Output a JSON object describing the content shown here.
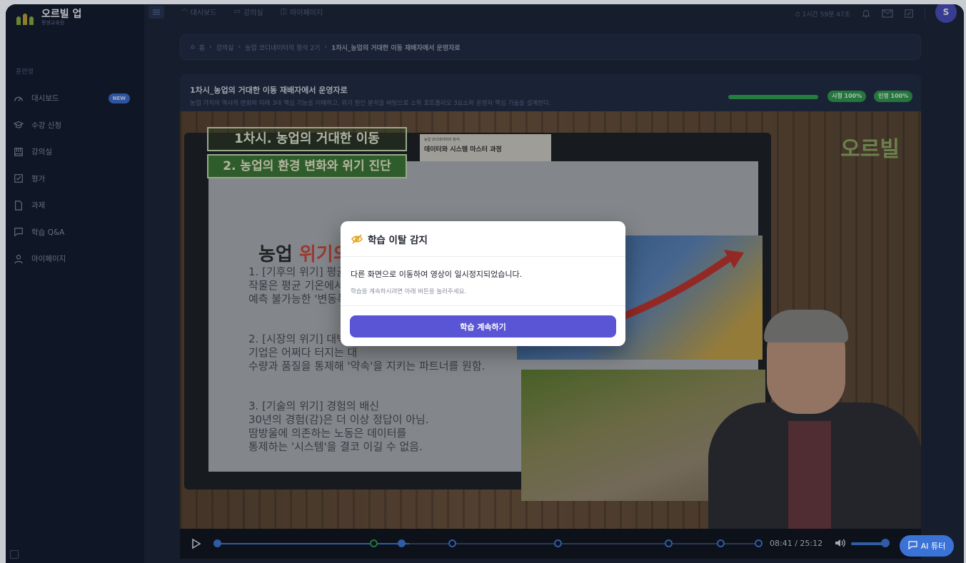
{
  "brand": {
    "title": "오르빌 업",
    "subtitle": "평생교육원"
  },
  "sidebar": {
    "section_label": "훈련생",
    "items": [
      {
        "label": "대시보드",
        "icon": "dashboard-icon",
        "badge": "NEW"
      },
      {
        "label": "수강 신청",
        "icon": "graduation-cap-icon"
      },
      {
        "label": "강의실",
        "icon": "classroom-icon"
      },
      {
        "label": "평가",
        "icon": "checkbox-icon"
      },
      {
        "label": "과제",
        "icon": "document-icon"
      },
      {
        "label": "학습 Q&A",
        "icon": "chat-icon"
      },
      {
        "label": "마이페이지",
        "icon": "user-icon"
      }
    ]
  },
  "topbar": {
    "links": [
      {
        "label": "대시보드",
        "icon": "dashboard-icon"
      },
      {
        "label": "강의실",
        "icon": "classroom-icon"
      },
      {
        "label": "마이페이지",
        "icon": "mypage-icon"
      }
    ],
    "timer": "⏱ 1시간 59분 47초",
    "avatar_initial": "S"
  },
  "breadcrumb": {
    "home": "홈",
    "items": [
      "강의실",
      "농업 코디네이터의 정석 2기"
    ],
    "current": "1차시_농업의 거대한 이동 재배자에서 운영자로"
  },
  "lecture": {
    "title": "1차시_농업의 거대한 이동 재배자에서 운영자로",
    "description": "농업 가치의 역사적 변화와 미래 3대 핵심 기능을 이해하고, 위기 원인 분석을 바탕으로 소득 포트폴리오 3요소와 운영자 핵심 기술을 설계한다.",
    "progress_percent": 100,
    "badge_view": "시청 100%",
    "badge_cert": "인정 100%"
  },
  "slide": {
    "title1": "1차시. 농업의 거대한 이동",
    "title2": "2. 농업의 환경 변화와 위기 진단",
    "course_small": "농업 코디네이터의 정석:",
    "course_big": "데이터와 시스템 마스터 과정",
    "brand": "오르빌",
    "heading_a": "농업 ",
    "heading_b": "위기의 본질",
    "p1_l1": "1. [기후의 위기] 평균의",
    "p1_l2": "작물은 평균 기온에서 자",
    "p1_l3": "예측 불가능한 '변동폭'에",
    "p2_l1": "2. [시장의 위기] 대박의",
    "p2_l2": "기업은 어쩌다 터지는 대",
    "p2_l3": "수량과 품질을 통제해 '약속'을 지키는 파트너를 원함.",
    "p3_l1": "3. [기술의 위기] 경험의 배신",
    "p3_l2": "30년의 경험(감)은 더 이상 정답이 아님.",
    "p3_l3": "땀방울에 의존하는 노동은 데이터를",
    "p3_l4": "통제하는 '시스템'을 결코 이길 수 없음."
  },
  "player": {
    "time": "08:41 / 25:12",
    "played_fraction": 0.355,
    "volume_fraction": 0.85,
    "chapter_markers": [
      0,
      0.289,
      0.34,
      0.434,
      0.629,
      0.834,
      0.93,
      1.0
    ]
  },
  "ai_tutor_label": "AI 튜터",
  "modal": {
    "title": "학습 이탈 감지",
    "message": "다른 화면으로 이동하여 영상이 일시정지되었습니다.",
    "hint": "학습을 계속하시려면 아래 버튼을 눌러주세요.",
    "button": "학습 계속하기"
  },
  "colors": {
    "accent": "#5a55d4",
    "success": "#2f9e4c",
    "player_blue": "#3f7bdc",
    "sidebar_bg": "#111a2c"
  }
}
